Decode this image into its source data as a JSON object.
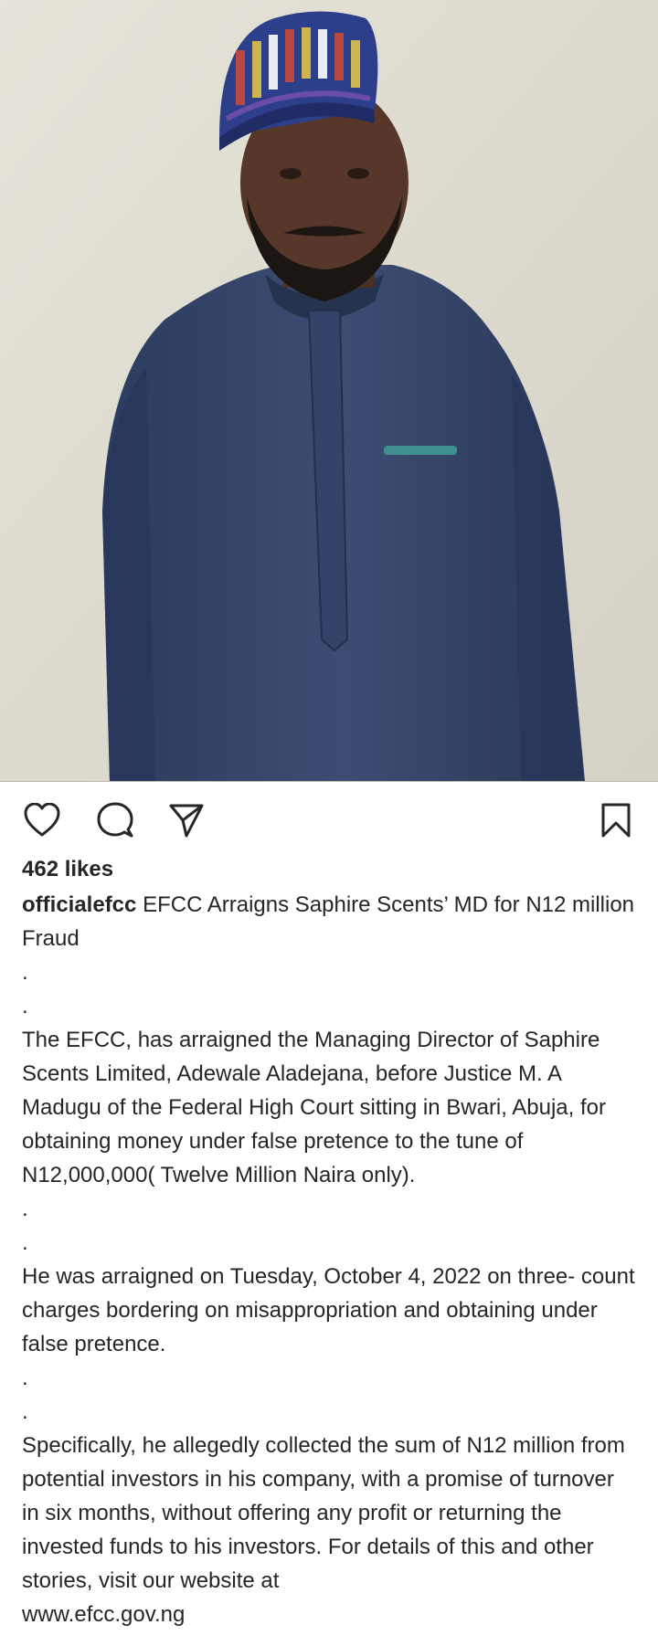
{
  "post": {
    "image_alt": "Man in blue kaftan and embroidered cap standing against a wall",
    "actions": {
      "like_icon": "heart-outline-icon",
      "comment_icon": "comment-bubble-icon",
      "share_icon": "paper-plane-icon",
      "save_icon": "bookmark-outline-icon"
    },
    "likes": "462 likes",
    "username": "officialefcc",
    "title": "EFCC Arraigns Saphire Scents’ MD for N12 million Fraud",
    "dot": ".",
    "paragraphs": [
      "The EFCC, has  arraigned the Managing Director of Saphire Scents Limited, Adewale Aladejana,  before Justice M. A Madugu of the Federal High Court sitting in Bwari, Abuja, for obtaining money under false pretence to the tune of N12,000,000( Twelve Million Naira only).",
      "He was arraigned on Tuesday,  October 4, 2022  on three- count charges bordering on misappropriation and obtaining under false pretence.",
      "Specifically,  he allegedly collected the sum of N12 million from potential  investors  in his company,  with a promise of turnover in six months, without offering any profit or returning the invested funds to his investors. For details of this and other stories, visit our website at"
    ],
    "website": "www.efcc.gov.ng"
  }
}
